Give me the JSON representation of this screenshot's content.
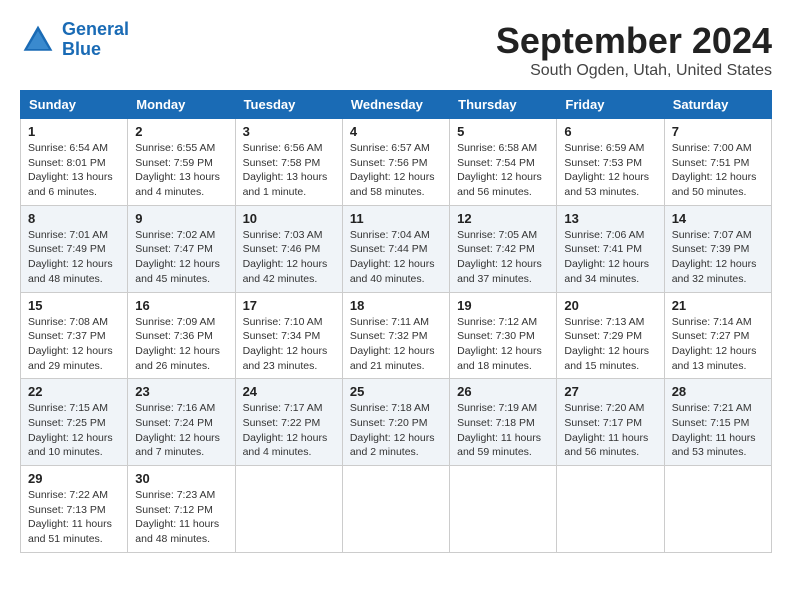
{
  "header": {
    "logo_line1": "General",
    "logo_line2": "Blue",
    "month": "September 2024",
    "location": "South Ogden, Utah, United States"
  },
  "weekdays": [
    "Sunday",
    "Monday",
    "Tuesday",
    "Wednesday",
    "Thursday",
    "Friday",
    "Saturday"
  ],
  "weeks": [
    [
      {
        "day": "1",
        "sunrise": "Sunrise: 6:54 AM",
        "sunset": "Sunset: 8:01 PM",
        "daylight": "Daylight: 13 hours and 6 minutes."
      },
      {
        "day": "2",
        "sunrise": "Sunrise: 6:55 AM",
        "sunset": "Sunset: 7:59 PM",
        "daylight": "Daylight: 13 hours and 4 minutes."
      },
      {
        "day": "3",
        "sunrise": "Sunrise: 6:56 AM",
        "sunset": "Sunset: 7:58 PM",
        "daylight": "Daylight: 13 hours and 1 minute."
      },
      {
        "day": "4",
        "sunrise": "Sunrise: 6:57 AM",
        "sunset": "Sunset: 7:56 PM",
        "daylight": "Daylight: 12 hours and 58 minutes."
      },
      {
        "day": "5",
        "sunrise": "Sunrise: 6:58 AM",
        "sunset": "Sunset: 7:54 PM",
        "daylight": "Daylight: 12 hours and 56 minutes."
      },
      {
        "day": "6",
        "sunrise": "Sunrise: 6:59 AM",
        "sunset": "Sunset: 7:53 PM",
        "daylight": "Daylight: 12 hours and 53 minutes."
      },
      {
        "day": "7",
        "sunrise": "Sunrise: 7:00 AM",
        "sunset": "Sunset: 7:51 PM",
        "daylight": "Daylight: 12 hours and 50 minutes."
      }
    ],
    [
      {
        "day": "8",
        "sunrise": "Sunrise: 7:01 AM",
        "sunset": "Sunset: 7:49 PM",
        "daylight": "Daylight: 12 hours and 48 minutes."
      },
      {
        "day": "9",
        "sunrise": "Sunrise: 7:02 AM",
        "sunset": "Sunset: 7:47 PM",
        "daylight": "Daylight: 12 hours and 45 minutes."
      },
      {
        "day": "10",
        "sunrise": "Sunrise: 7:03 AM",
        "sunset": "Sunset: 7:46 PM",
        "daylight": "Daylight: 12 hours and 42 minutes."
      },
      {
        "day": "11",
        "sunrise": "Sunrise: 7:04 AM",
        "sunset": "Sunset: 7:44 PM",
        "daylight": "Daylight: 12 hours and 40 minutes."
      },
      {
        "day": "12",
        "sunrise": "Sunrise: 7:05 AM",
        "sunset": "Sunset: 7:42 PM",
        "daylight": "Daylight: 12 hours and 37 minutes."
      },
      {
        "day": "13",
        "sunrise": "Sunrise: 7:06 AM",
        "sunset": "Sunset: 7:41 PM",
        "daylight": "Daylight: 12 hours and 34 minutes."
      },
      {
        "day": "14",
        "sunrise": "Sunrise: 7:07 AM",
        "sunset": "Sunset: 7:39 PM",
        "daylight": "Daylight: 12 hours and 32 minutes."
      }
    ],
    [
      {
        "day": "15",
        "sunrise": "Sunrise: 7:08 AM",
        "sunset": "Sunset: 7:37 PM",
        "daylight": "Daylight: 12 hours and 29 minutes."
      },
      {
        "day": "16",
        "sunrise": "Sunrise: 7:09 AM",
        "sunset": "Sunset: 7:36 PM",
        "daylight": "Daylight: 12 hours and 26 minutes."
      },
      {
        "day": "17",
        "sunrise": "Sunrise: 7:10 AM",
        "sunset": "Sunset: 7:34 PM",
        "daylight": "Daylight: 12 hours and 23 minutes."
      },
      {
        "day": "18",
        "sunrise": "Sunrise: 7:11 AM",
        "sunset": "Sunset: 7:32 PM",
        "daylight": "Daylight: 12 hours and 21 minutes."
      },
      {
        "day": "19",
        "sunrise": "Sunrise: 7:12 AM",
        "sunset": "Sunset: 7:30 PM",
        "daylight": "Daylight: 12 hours and 18 minutes."
      },
      {
        "day": "20",
        "sunrise": "Sunrise: 7:13 AM",
        "sunset": "Sunset: 7:29 PM",
        "daylight": "Daylight: 12 hours and 15 minutes."
      },
      {
        "day": "21",
        "sunrise": "Sunrise: 7:14 AM",
        "sunset": "Sunset: 7:27 PM",
        "daylight": "Daylight: 12 hours and 13 minutes."
      }
    ],
    [
      {
        "day": "22",
        "sunrise": "Sunrise: 7:15 AM",
        "sunset": "Sunset: 7:25 PM",
        "daylight": "Daylight: 12 hours and 10 minutes."
      },
      {
        "day": "23",
        "sunrise": "Sunrise: 7:16 AM",
        "sunset": "Sunset: 7:24 PM",
        "daylight": "Daylight: 12 hours and 7 minutes."
      },
      {
        "day": "24",
        "sunrise": "Sunrise: 7:17 AM",
        "sunset": "Sunset: 7:22 PM",
        "daylight": "Daylight: 12 hours and 4 minutes."
      },
      {
        "day": "25",
        "sunrise": "Sunrise: 7:18 AM",
        "sunset": "Sunset: 7:20 PM",
        "daylight": "Daylight: 12 hours and 2 minutes."
      },
      {
        "day": "26",
        "sunrise": "Sunrise: 7:19 AM",
        "sunset": "Sunset: 7:18 PM",
        "daylight": "Daylight: 11 hours and 59 minutes."
      },
      {
        "day": "27",
        "sunrise": "Sunrise: 7:20 AM",
        "sunset": "Sunset: 7:17 PM",
        "daylight": "Daylight: 11 hours and 56 minutes."
      },
      {
        "day": "28",
        "sunrise": "Sunrise: 7:21 AM",
        "sunset": "Sunset: 7:15 PM",
        "daylight": "Daylight: 11 hours and 53 minutes."
      }
    ],
    [
      {
        "day": "29",
        "sunrise": "Sunrise: 7:22 AM",
        "sunset": "Sunset: 7:13 PM",
        "daylight": "Daylight: 11 hours and 51 minutes."
      },
      {
        "day": "30",
        "sunrise": "Sunrise: 7:23 AM",
        "sunset": "Sunset: 7:12 PM",
        "daylight": "Daylight: 11 hours and 48 minutes."
      },
      null,
      null,
      null,
      null,
      null
    ]
  ]
}
